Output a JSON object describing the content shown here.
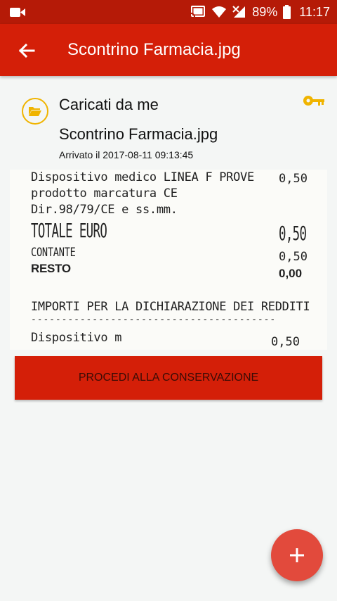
{
  "status": {
    "battery": "89%",
    "time": "11:17"
  },
  "appbar": {
    "title": "Scontrino Farmacia.jpg"
  },
  "file": {
    "origin": "Caricati da me",
    "name": "Scontrino Farmacia.jpg",
    "arrived": "Arrivato il 2017-08-11 09:13:45"
  },
  "receipt": {
    "line1": "Dispositivo medico LINEA F PROVE",
    "line1_value": "0,50",
    "line2": "prodotto marcatura CE",
    "line3": "Dir.98/79/CE e ss.mm.",
    "total_label": "TOTALE EURO",
    "total_value": "0,50",
    "cash_label": "CONTANTE",
    "cash_value": "0,50",
    "change_label": "RESTO",
    "change_value": "0,00",
    "tax_header": "IMPORTI PER LA DICHIARAZIONE DEI REDDITI",
    "separator": "----------------------------------------",
    "item_label": "Dispositivo m",
    "item_value": "0,50"
  },
  "actions": {
    "proceed": "PROCEDI ALLA CONSERVAZIONE",
    "fab": "+"
  },
  "colors": {
    "status_bar": "#b51a07",
    "app_bar": "#d41f08",
    "button": "#d41f08",
    "fab": "#e24a3c",
    "accent_yellow": "#f0b400"
  },
  "icons": {
    "back": "arrow-back-icon",
    "folder": "folder-open-icon",
    "key": "key-icon",
    "add": "add-icon"
  }
}
